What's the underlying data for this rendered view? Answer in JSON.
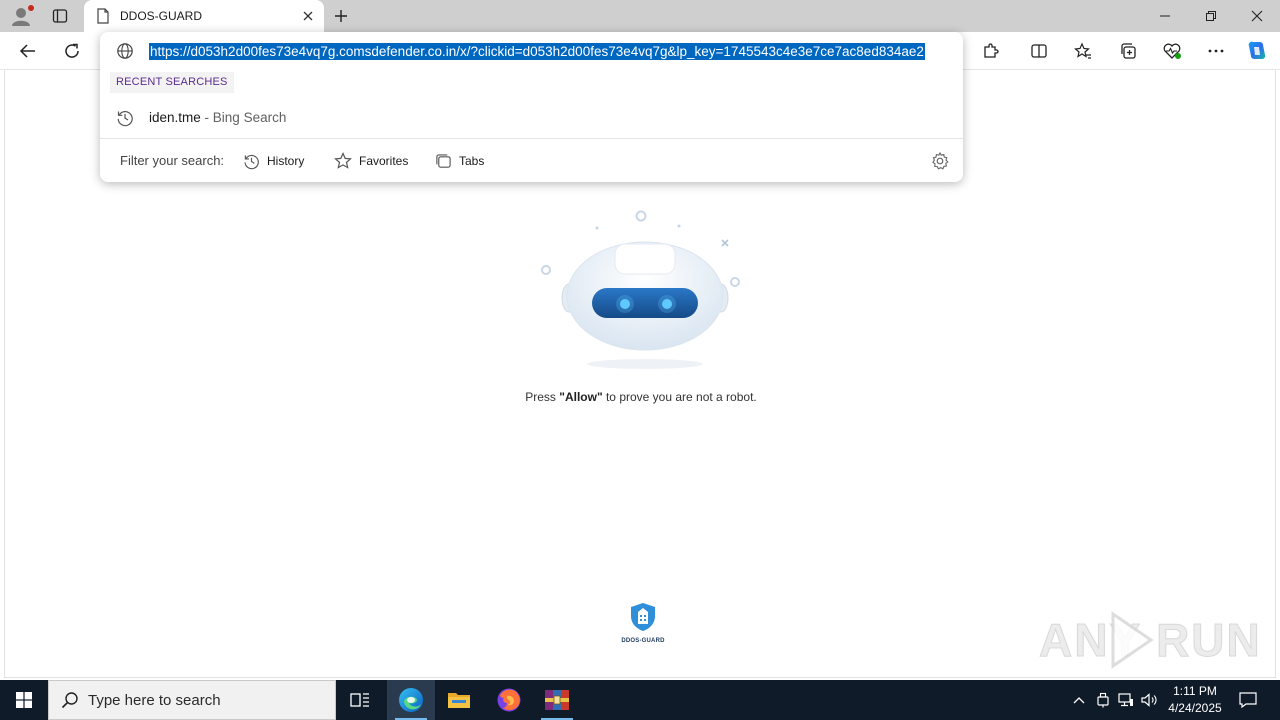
{
  "browser": {
    "tab_title": "DDOS-GUARD",
    "address": "https://d053h2d00fes73e4vq7g.comsdefender.co.in/x/?clickid=d053h2d00fes73e4vq7g&lp_key=1745543c4e3e7ce7ac8ed834ae2"
  },
  "omnibox": {
    "recent_label": "RECENT SEARCHES",
    "suggestion": {
      "query": "iden.tme",
      "source": "- Bing Search"
    },
    "filter_label": "Filter your search:",
    "filters": [
      {
        "label": "History",
        "icon": "history-icon"
      },
      {
        "label": "Favorites",
        "icon": "star-icon"
      },
      {
        "label": "Tabs",
        "icon": "tabs-icon"
      }
    ]
  },
  "page": {
    "message_prefix": "Press ",
    "message_bold": "\"Allow\"",
    "message_suffix": " to prove you are not a robot.",
    "logo_text": "DDOS-GUARD",
    "watermark_text": "ANY RUN"
  },
  "taskbar": {
    "search_placeholder": "Type here to search",
    "time": "1:11 PM",
    "date": "4/24/2025"
  },
  "colors": {
    "accent": "#0067c0",
    "recent_label": "#5c2d91",
    "taskbar": "#101b29",
    "robot_visor": "#1f5fa6"
  }
}
